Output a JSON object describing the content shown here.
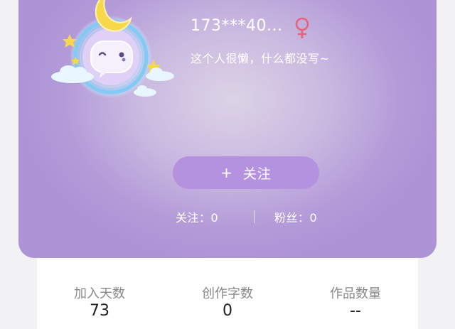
{
  "profile": {
    "username": "173***40...",
    "gender_icon": "female-icon",
    "bio": "这个人很懒，什么都没写~",
    "follow_button": {
      "plus": "+",
      "label": "关注"
    },
    "following": {
      "label": "关注：",
      "value": "0"
    },
    "followers": {
      "label": "粉丝：",
      "value": "0"
    }
  },
  "stats": [
    {
      "label": "加入天数",
      "value": "73"
    },
    {
      "label": "创作字数",
      "value": "0"
    },
    {
      "label": "作品数量",
      "value": "--"
    }
  ],
  "colors": {
    "card_gradient": "#b39ad8",
    "follow_button": "#b592e0",
    "gender_icon": "#e8637a",
    "moon": "#f7d84a"
  }
}
